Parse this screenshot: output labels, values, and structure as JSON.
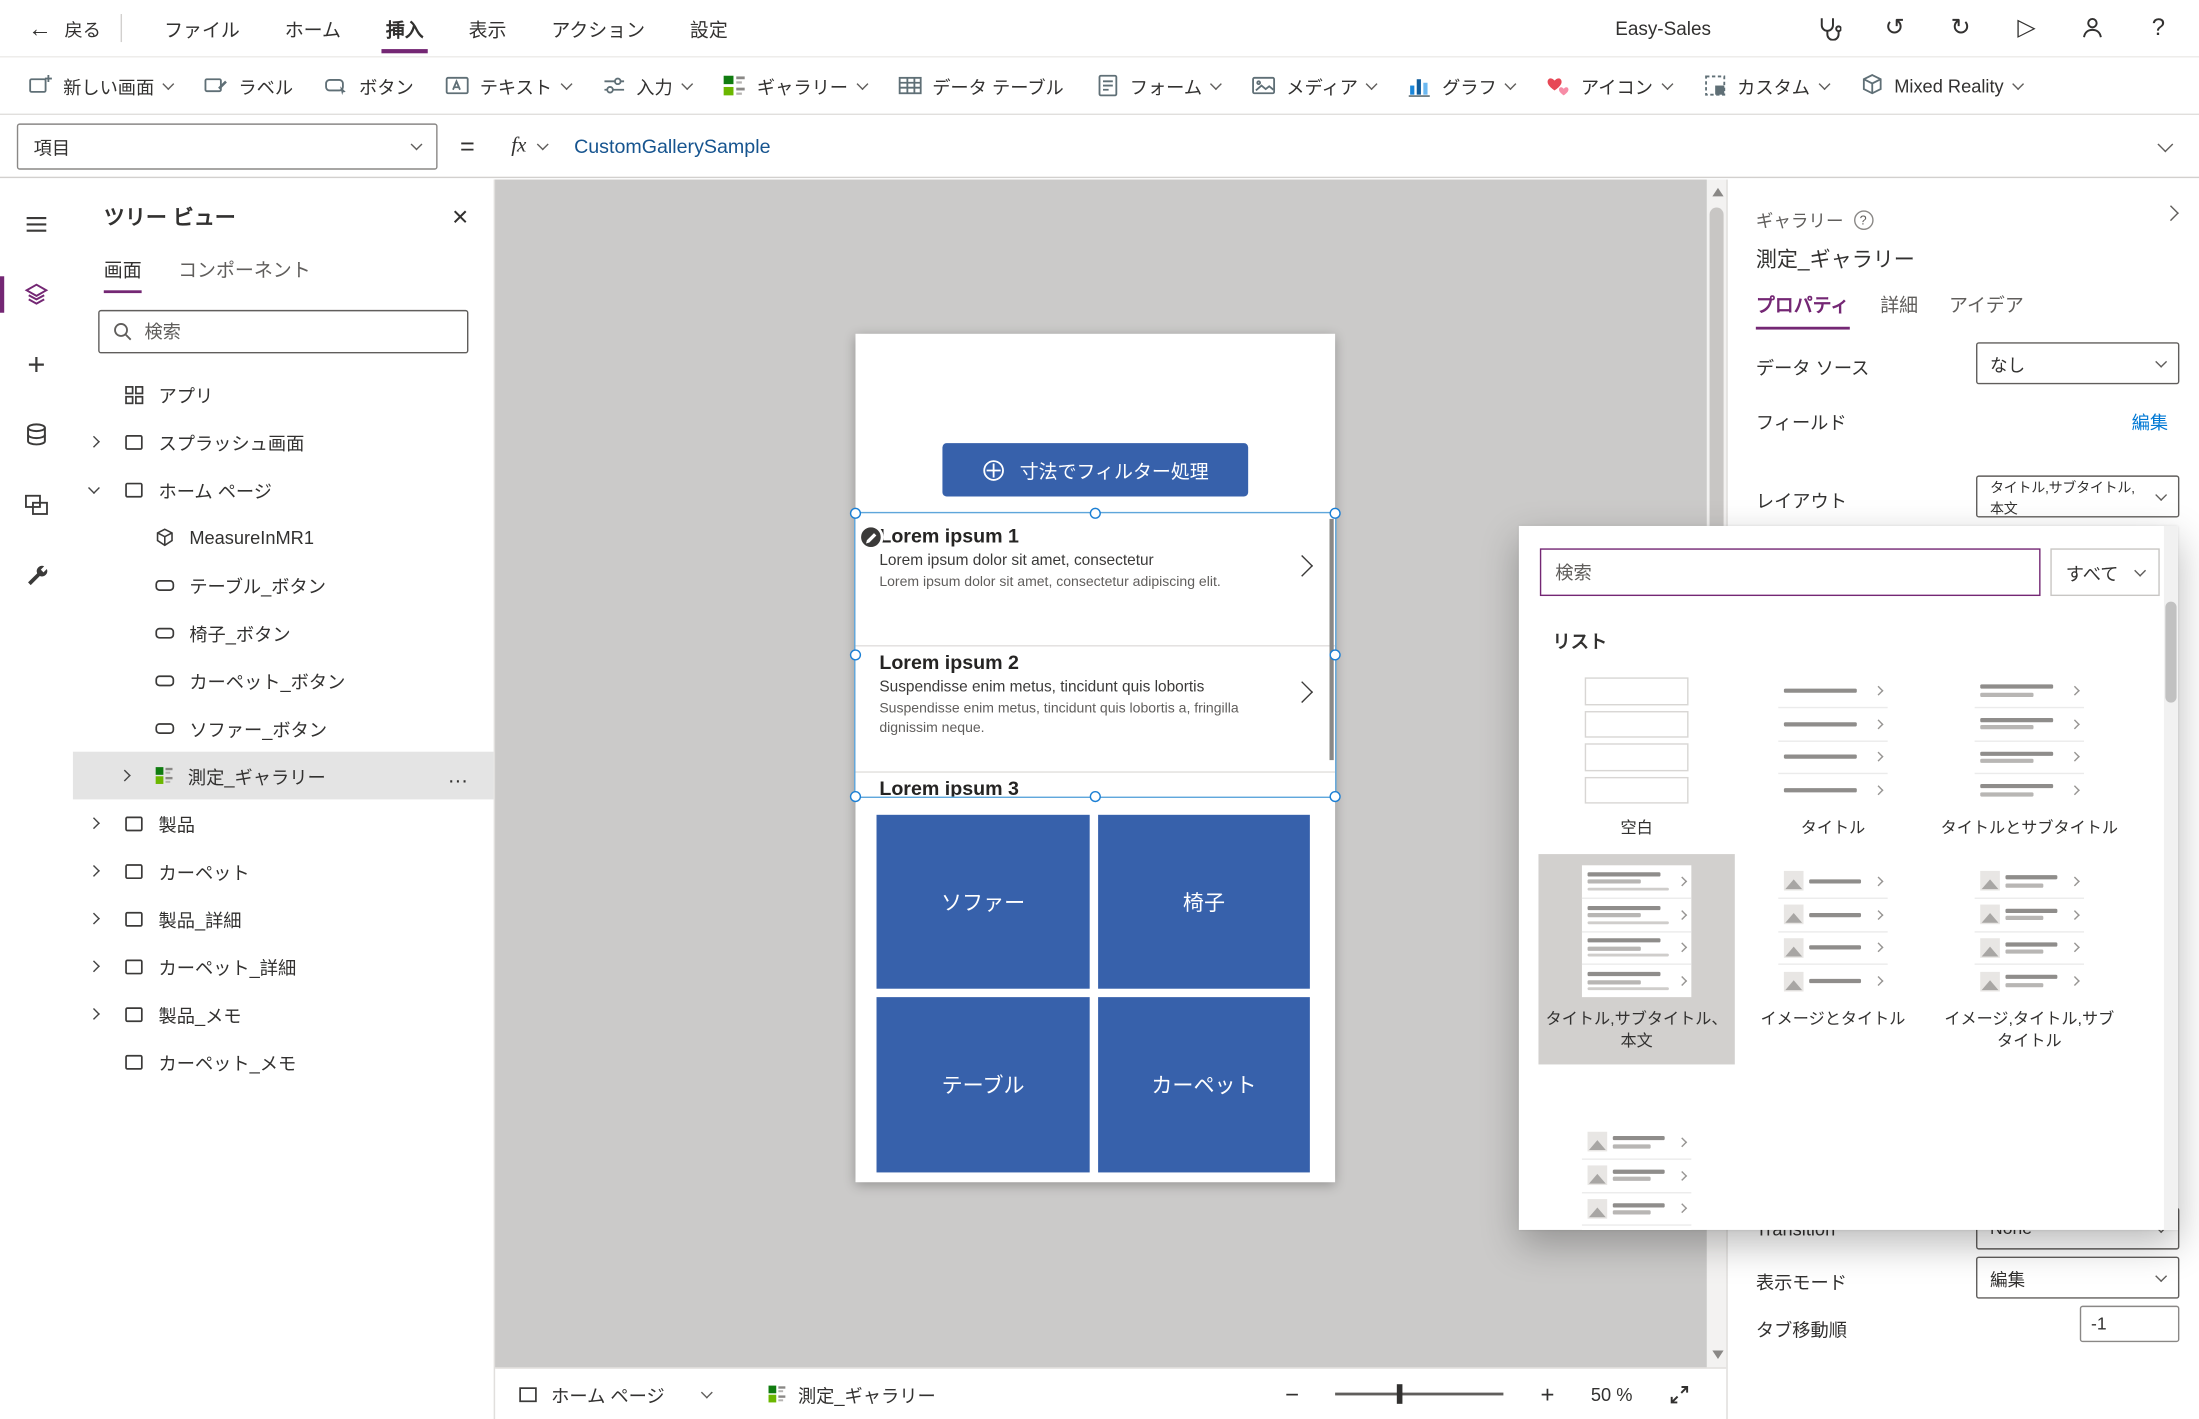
{
  "colors": {
    "accent_purple": "#742774",
    "primary_blue": "#3761ab",
    "link_blue": "#0078d4",
    "canvas_gray": "#cbcac9"
  },
  "icons": {
    "back": "←",
    "close": "×",
    "undo": "↺",
    "redo": "↻",
    "play": "▷",
    "help": "?",
    "more": "…",
    "zoom_out": "−",
    "zoom_in": "+",
    "add": "+"
  },
  "topbar": {
    "back_label": "戻る",
    "menus": [
      {
        "label": "ファイル"
      },
      {
        "label": "ホーム"
      },
      {
        "label": "挿入",
        "active": true
      },
      {
        "label": "表示"
      },
      {
        "label": "アクション"
      },
      {
        "label": "設定"
      }
    ],
    "app_name": "Easy-Sales"
  },
  "ribbon": {
    "items": [
      {
        "label": "新しい画面"
      },
      {
        "label": "ラベル"
      },
      {
        "label": "ボタン"
      },
      {
        "label": "テキスト"
      },
      {
        "label": "入力"
      },
      {
        "label": "ギャラリー"
      },
      {
        "label": "データ テーブル"
      },
      {
        "label": "フォーム"
      },
      {
        "label": "メディア"
      },
      {
        "label": "グラフ"
      },
      {
        "label": "アイコン"
      },
      {
        "label": "カスタム"
      },
      {
        "label": "Mixed Reality"
      }
    ]
  },
  "formula_bar": {
    "property_selector": "項目",
    "equals_sign": "=",
    "fx_label": "fx",
    "formula": "CustomGallerySample"
  },
  "tree_panel": {
    "title": "ツリー ビュー",
    "tabs": [
      {
        "label": "画面",
        "active": true
      },
      {
        "label": "コンポーネント"
      }
    ],
    "search_placeholder": "検索",
    "items": [
      {
        "label": "アプリ"
      },
      {
        "label": "スプラッシュ画面"
      },
      {
        "label": "ホーム ページ"
      },
      {
        "label": "MeasureInMR1"
      },
      {
        "label": "テーブル_ボタン"
      },
      {
        "label": "椅子_ボタン"
      },
      {
        "label": "カーペット_ボタン"
      },
      {
        "label": "ソファー_ボタン"
      },
      {
        "label": "測定_ギャラリー",
        "selected": true
      },
      {
        "label": "製品"
      },
      {
        "label": "カーペット"
      },
      {
        "label": "製品_詳細"
      },
      {
        "label": "カーペット_詳細"
      },
      {
        "label": "製品_メモ"
      },
      {
        "label": "カーペット_メモ"
      }
    ]
  },
  "canvas": {
    "filter_button_label": "寸法でフィルター処理",
    "gallery": {
      "items": [
        {
          "title": "Lorem ipsum 1",
          "subtitle": "Lorem ipsum dolor sit amet, consectetur",
          "body": "Lorem ipsum dolor sit amet, consectetur adipiscing elit."
        },
        {
          "title": "Lorem ipsum 2",
          "subtitle": "Suspendisse enim metus, tincidunt quis lobortis",
          "body": "Suspendisse enim metus, tincidunt quis lobortis a, fringilla dignissim neque."
        },
        {
          "title": "Lorem ipsum 3"
        }
      ]
    },
    "tiles": [
      {
        "label": "ソファー"
      },
      {
        "label": "椅子"
      },
      {
        "label": "テーブル"
      },
      {
        "label": "カーペット"
      }
    ]
  },
  "status_bar": {
    "page_selector": "ホーム ページ",
    "selected_control": "測定_ギャラリー",
    "zoom_value": "50 %"
  },
  "properties_panel": {
    "control_type": "ギャラリー",
    "control_name": "測定_ギャラリー",
    "tabs": [
      {
        "label": "プロパティ",
        "active": true
      },
      {
        "label": "詳細"
      },
      {
        "label": "アイデア"
      }
    ],
    "fields": {
      "data_source_label": "データ ソース",
      "data_source_value": "なし",
      "fields_label": "フィールド",
      "fields_edit": "編集",
      "layout_label": "レイアウト",
      "layout_value": "タイトル,サブタイトル,本文",
      "transition_label": "Transition",
      "transition_value": "None",
      "display_mode_label": "表示モード",
      "display_mode_value": "編集",
      "tab_order_label": "タブ移動順",
      "tab_order_value": "-1"
    }
  },
  "layout_flyout": {
    "search_placeholder": "検索",
    "filter_value": "すべて",
    "section_title": "リスト",
    "options": [
      {
        "label": "空白"
      },
      {
        "label": "タイトル"
      },
      {
        "label": "タイトルとサブタイトル"
      },
      {
        "label": "タイトル,サブタイトル、本文",
        "selected": true
      },
      {
        "label": "イメージとタイトル"
      },
      {
        "label": "イメージ,タイトル,サブタイトル"
      }
    ]
  }
}
